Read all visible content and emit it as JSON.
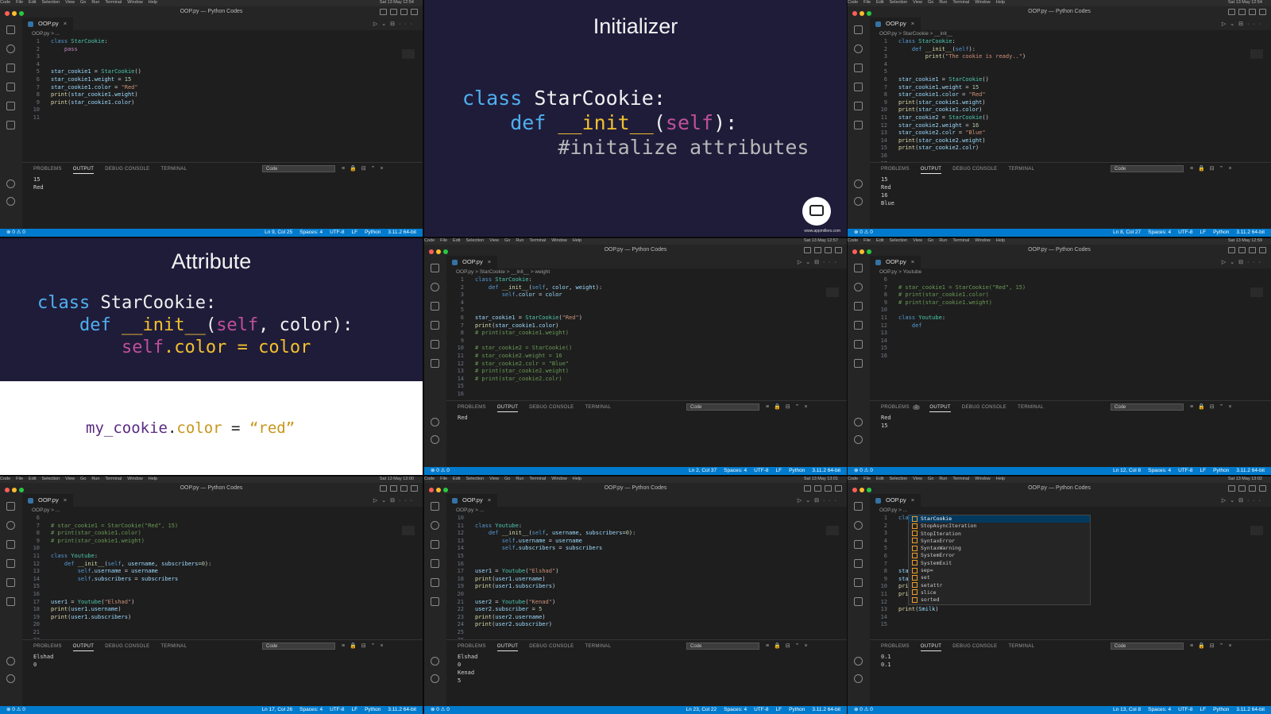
{
  "screen": {
    "menubar": [
      "Code",
      "File",
      "Edit",
      "Selection",
      "View",
      "Go",
      "Run",
      "Terminal",
      "Window",
      "Help"
    ]
  },
  "editor": {
    "window_title": "OOP.py — Python Codes",
    "tab": "OOP.py",
    "panel_tabs": [
      "PROBLEMS",
      "OUTPUT",
      "DEBUG CONSOLE",
      "TERMINAL"
    ],
    "output_channel": "Code",
    "status_left": "⊗ 0 ⚠ 0",
    "encoding": "UTF-8",
    "eol": "LF",
    "language": "Python",
    "interpreter": "3.11.2 64-bit"
  },
  "panels": [
    {
      "id": "p1",
      "menubar_time": "Sat 13 May 12:54",
      "crumb": "OOP.py > ...",
      "code": [
        "class StarCookie:",
        "    pass",
        "",
        "",
        "star_cookie1 = StarCookie()",
        "star_cookie1.weight = 15",
        "star_cookie1.color = \"Red\"",
        "print(star_cookie1.weight)",
        "print(star_cookie1.color)",
        "",
        ""
      ],
      "output": [
        "15",
        "Red"
      ],
      "status_pos": "Ln 9, Col 25",
      "status_spaces": "Spaces: 4"
    },
    {
      "id": "p2",
      "title": "Initializer",
      "code": [
        "class StarCookie:",
        "    def __init__(self):",
        "        #initalize attributes"
      ],
      "logo_caption": "www.appmillers.com"
    },
    {
      "id": "p3",
      "menubar_time": "Sat 13 May 12:54",
      "crumb": "OOP.py > StarCookie > __init__",
      "code": [
        "class StarCookie:",
        "    def __init__(self):",
        "        print(\"The cookie is ready..\")",
        "",
        "",
        "star_cookie1 = StarCookie()",
        "star_cookie1.weight = 15",
        "star_cookie1.color = \"Red\"",
        "print(star_cookie1.weight)",
        "print(star_cookie1.color)",
        "star_cookie2 = StarCookie()",
        "star_cookie2.weight = 16",
        "star_cookie2.colr = \"Blue\"",
        "print(star_cookie2.weight)",
        "print(star_cookie2.colr)",
        "",
        ""
      ],
      "output": [
        "15",
        "Red",
        "16",
        "Blue"
      ],
      "status_pos": "Ln 8, Col 27",
      "status_spaces": "Spaces: 4"
    },
    {
      "id": "p4",
      "title": "Attribute",
      "code": [
        "class StarCookie:",
        "    def __init__(self, color):",
        "        self.color = color"
      ],
      "bottom_code": "my_cookie.color = “red”"
    },
    {
      "id": "p5",
      "menubar_time": "Sat 13 May 12:57",
      "crumb": "OOP.py > StarCookie > __init__ > weight",
      "code": [
        "class StarCookie:",
        "    def __init__(self, color, weight):",
        "        self.color = color",
        "",
        "",
        "star_cookie1 = StarCookie(\"Red\")",
        "print(star_cookie1.color)",
        "# print(star_cookie1.weight)",
        "",
        "# star_cookie2 = StarCookie()",
        "# star_cookie2.weight = 16",
        "# star_cookie2.colr = \"Blue\"",
        "# print(star_cookie2.weight)",
        "# print(star_cookie2.colr)",
        "",
        ""
      ],
      "output": [
        "Red"
      ],
      "status_pos": "Ln 2, Col 37",
      "status_spaces": "Spaces: 4"
    },
    {
      "id": "p6",
      "menubar_time": "Sat 13 May 12:59",
      "crumb": "OOP.py > Youtube",
      "code_start": 6,
      "code": [
        "",
        "# star_cookie1 = StarCookie(\"Red\", 15)",
        "# print(star_cookie1.color)",
        "# print(star_cookie1.weight)",
        "",
        "class Youtube:",
        "    def",
        "",
        "",
        "",
        ""
      ],
      "output": [
        "Red",
        "15"
      ],
      "problems_badge": "2",
      "status_pos": "Ln 12, Col 8",
      "status_spaces": "Spaces: 4"
    },
    {
      "id": "p7",
      "menubar_time": "Sat 13 May 13:00",
      "crumb": "OOP.py > ...",
      "code_start": 6,
      "code": [
        "",
        "# star_cookie1 = StarCookie(\"Red\", 15)",
        "# print(star_cookie1.color)",
        "# print(star_cookie1.weight)",
        "",
        "class Youtube:",
        "    def __init__(self, username, subscribers=0):",
        "        self.username = username",
        "        self.subscribers = subscribers",
        "",
        "",
        "user1 = Youtube(\"Elshad\")",
        "print(user1.username)",
        "print(user1.subscribers)",
        "",
        "",
        ""
      ],
      "output": [
        "Elshad",
        "0"
      ],
      "status_pos": "Ln 17, Col 26",
      "status_spaces": "Spaces: 4"
    },
    {
      "id": "p8",
      "menubar_time": "Sat 13 May 13:01",
      "crumb": "OOP.py > ...",
      "code_start": 10,
      "code": [
        "",
        "class Youtube:",
        "    def __init__(self, username, subscribers=0):",
        "        self.username = username",
        "        self.subscribers = subscribers",
        "",
        "",
        "user1 = Youtube(\"Elshad\")",
        "print(user1.username)",
        "print(user1.subscribers)",
        "",
        "user2 = Youtube(\"Kenad\")",
        "user2.subscriber = 5",
        "print(user2.username)",
        "print(user2.subscriber)",
        "",
        ""
      ],
      "output": [
        "Elshad",
        "0",
        "Kenad",
        "5"
      ],
      "status_pos": "Ln 23, Col 22",
      "status_spaces": "Spaces: 4"
    },
    {
      "id": "p9",
      "menubar_time": "Sat 13 May 13:02",
      "crumb": "OOP.py > ...",
      "code": [
        "class S",
        "    mil",
        "",
        "    def",
        "",
        "",
        "",
        "star_co",
        "star_co",
        "print(s",
        "print(s",
        "",
        "print(Smilk)",
        "",
        ""
      ],
      "autocomplete": [
        "StarCookie",
        "StopAsyncIteration",
        "StopIteration",
        "SyntaxError",
        "SyntaxWarning",
        "SystemError",
        "SystemExit",
        "sep=",
        "set",
        "setattr",
        "slice",
        "sorted"
      ],
      "output": [
        "0.1",
        "0.1"
      ],
      "status_pos": "Ln 13, Col 8",
      "status_spaces": "Spaces: 4"
    }
  ]
}
